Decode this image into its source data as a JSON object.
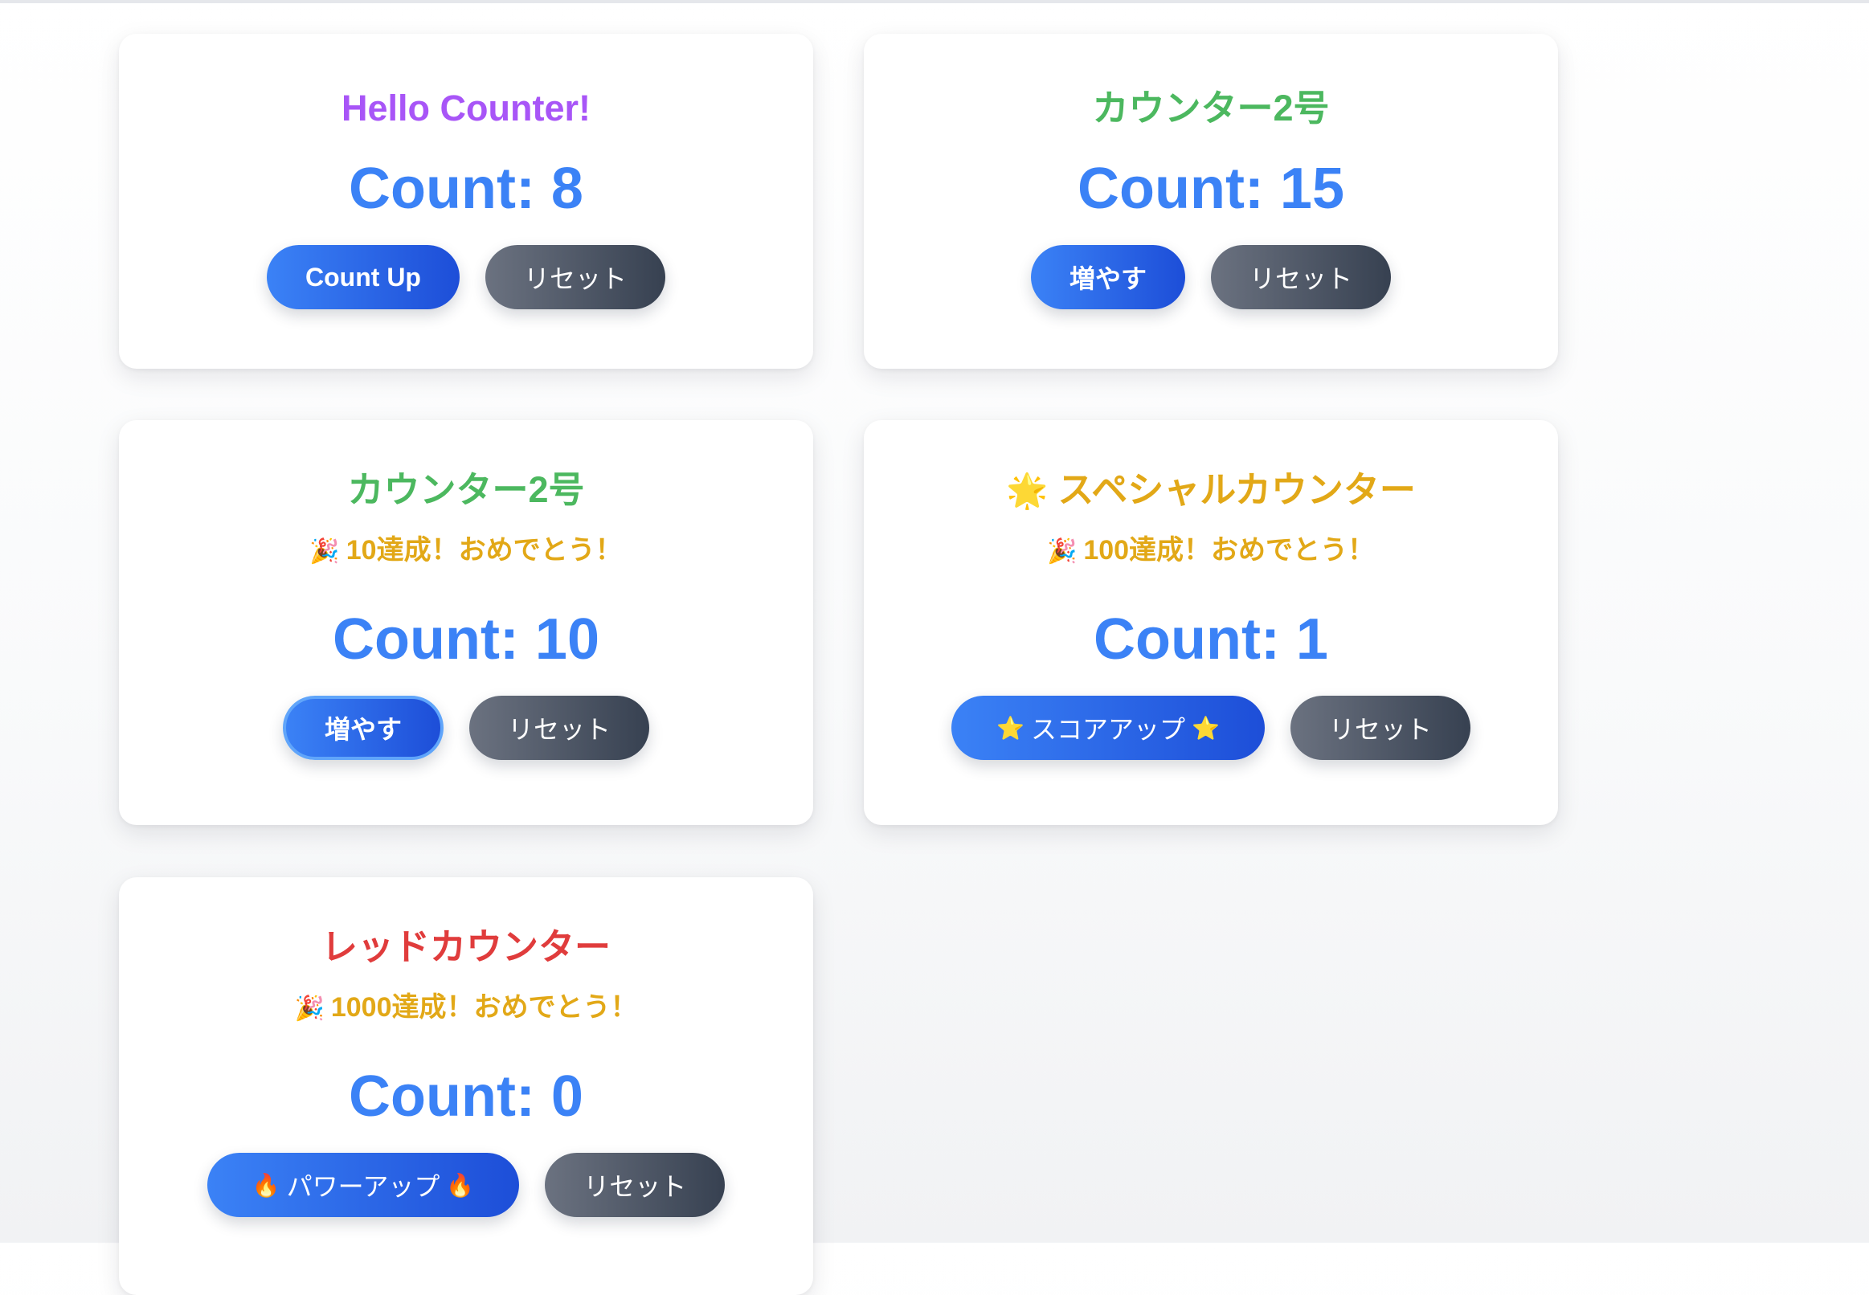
{
  "counters": [
    {
      "title": "Hello Counter!",
      "count": "Count: 8",
      "increment_label": "Count Up",
      "reset_label": "リセット"
    },
    {
      "title": "カウンター2号",
      "count": "Count: 15",
      "increment_label": "増やす",
      "reset_label": "リセット"
    },
    {
      "title": "カウンター2号",
      "message": "10達成！おめでとう！",
      "count": "Count: 10",
      "increment_label": "増やす",
      "reset_label": "リセット"
    },
    {
      "title": "スペシャルカウンター",
      "message": "100達成！おめでとう！",
      "count": "Count: 1",
      "increment_label": "スコアアップ",
      "reset_label": "リセット"
    },
    {
      "title": "レッドカウンター",
      "message": "1000達成！おめでとう！",
      "count": "Count: 0",
      "increment_label": "パワーアップ",
      "reset_label": "リセット"
    }
  ],
  "icons": {
    "party": "party-popper-icon",
    "sparkle": "glowing-star-icon",
    "star": "star-icon",
    "fire": "fire-icon"
  },
  "colors": {
    "count_blue": "#3b82f6",
    "title_purple": "#a855f7",
    "title_green": "#4cb85f",
    "title_gold": "#e2a817",
    "title_red": "#e03c3c",
    "message_gold": "#e2a817",
    "primary_start": "#3b82f6",
    "primary_end": "#1d4ed8",
    "secondary_start": "#6b7280",
    "secondary_end": "#374151"
  }
}
